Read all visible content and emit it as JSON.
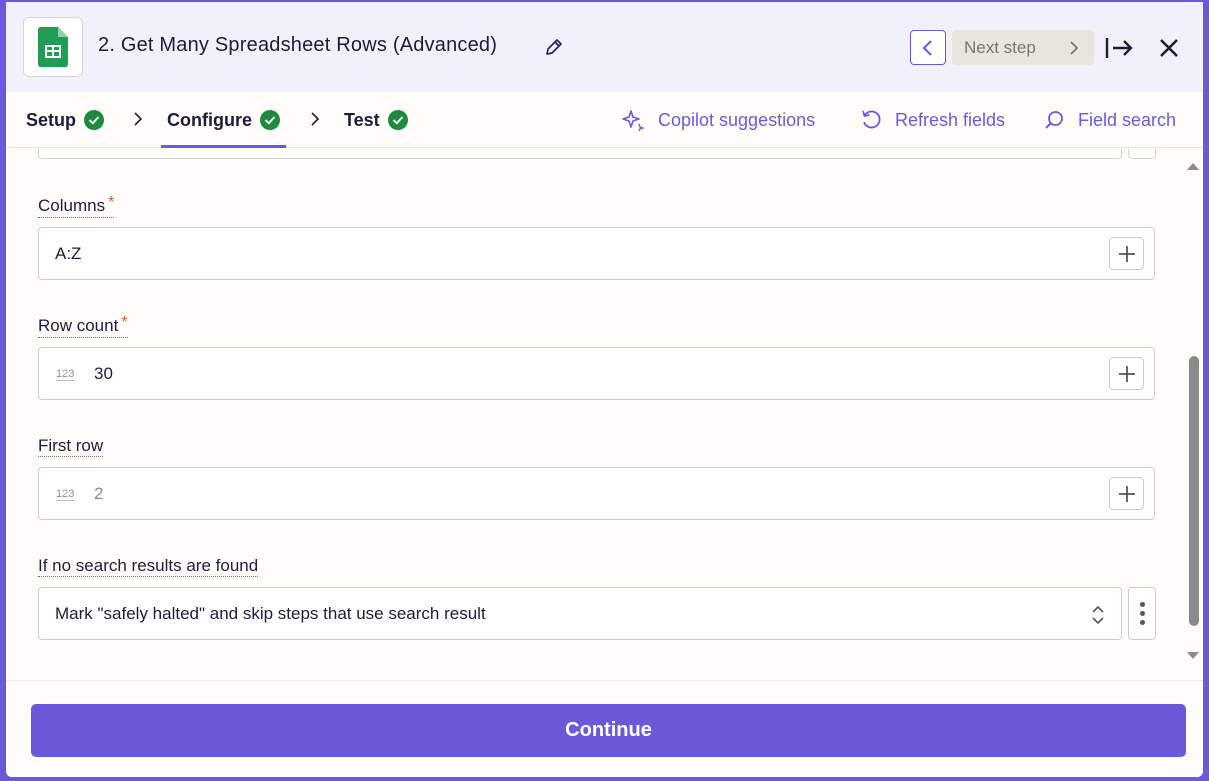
{
  "header": {
    "title": "2. Get Many Spreadsheet Rows (Advanced)",
    "app_icon": "google-sheets-icon",
    "next_step_label": "Next step"
  },
  "tabs": [
    {
      "label": "Setup",
      "status": "complete"
    },
    {
      "label": "Configure",
      "status": "complete",
      "active": true
    },
    {
      "label": "Test",
      "status": "complete"
    }
  ],
  "actions": {
    "copilot": "Copilot suggestions",
    "refresh": "Refresh fields",
    "search": "Field search"
  },
  "fields": {
    "columns": {
      "label": "Columns",
      "required": "*",
      "value": "A:Z"
    },
    "row_count": {
      "label": "Row count",
      "required": "*",
      "type_icon": "123",
      "value": "30"
    },
    "first_row": {
      "label": "First row",
      "type_icon": "123",
      "placeholder": "2"
    },
    "no_results": {
      "label": "If no search results are found",
      "value": "Mark \"safely halted\" and skip steps that use search result"
    }
  },
  "footer": {
    "continue_label": "Continue"
  },
  "colors": {
    "accent": "#6b5ad8",
    "success": "#1b8a3a",
    "required": "#e2571e"
  }
}
